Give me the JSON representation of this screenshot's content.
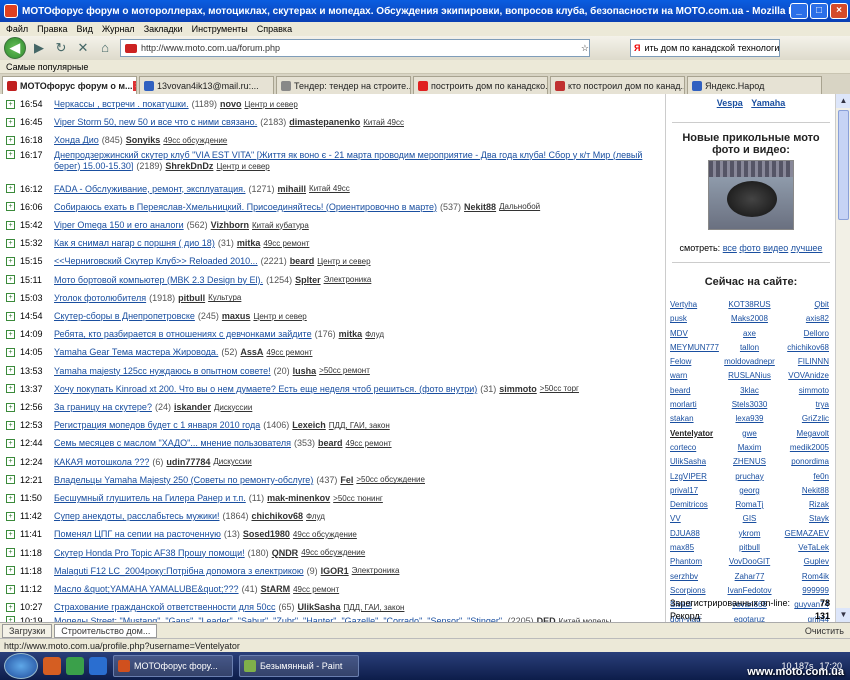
{
  "window": {
    "title": "МОТОфорус форум о мотороллерах, мотоциклах, скутерах и мопедах. Обсуждения экипировки, вопросов клуба, безопасности на MOTO.com.ua - Mozilla Firefox"
  },
  "menu": [
    "Файл",
    "Правка",
    "Вид",
    "Журнал",
    "Закладки",
    "Инструменты",
    "Справка"
  ],
  "address": {
    "url": "http://www.moto.com.ua/forum.php"
  },
  "search": {
    "engine": "Я",
    "value": "ить дом по канадской технологии"
  },
  "bookmarks": {
    "label": "Самые популярные"
  },
  "tabs": [
    {
      "label": "МОТОфорус форум о м...",
      "color": "#c02020"
    },
    {
      "label": "13vovan4ik13@mail.ru:...",
      "color": "#3060c0"
    },
    {
      "label": "Тендер: тендер на строите...",
      "color": "#888888"
    },
    {
      "label": "построить дом по канадско...",
      "color": "#e02020"
    },
    {
      "label": "кто построил дом по канад...",
      "color": "#c03030"
    },
    {
      "label": "Яндекс.Народ",
      "color": "#3060c0"
    }
  ],
  "topics": [
    {
      "time": "16:54",
      "title": "Черкассы , встречи . покатушки.",
      "count": "(1189)",
      "author": "novo",
      "cat": "Центр и север"
    },
    {
      "time": "16:45",
      "title": "Viper Storm 50, new 50 и все что с ними связано.",
      "count": "(2183)",
      "author": "dimastepanenko",
      "cat": "Китай 49сс"
    },
    {
      "time": "16:18",
      "title": "Хонда Дио",
      "count": "(845)",
      "author": "Sonyiks",
      "cat": "49сс обсуждение"
    },
    {
      "time": "16:17",
      "title": "Днепродзержинский скутер клуб \"VIA EST VITA\" [Життя як воно є - 21 марта проводим мероприятие - Два года клуба! Сбор у к/т Мир (левый берег) 15.00-15.30]",
      "count": "(2189)",
      "author": "ShrekDnDz",
      "cat": "Центр и север"
    },
    {
      "time": "16:12",
      "title": "FADA - Обслуживание, ремонт, эксплуатация.",
      "count": "(1271)",
      "author": "mihaill",
      "cat": "Китай 49сс"
    },
    {
      "time": "16:06",
      "title": "Собираюсь ехать в Переяслав-Хмельницкий. Присоединяйтесь! (Ориентировочно в марте)",
      "count": "(537)",
      "author": "Nekit88",
      "cat": "Дальнобой"
    },
    {
      "time": "15:42",
      "title": "Viper Omega 150 и его аналоги",
      "count": "(562)",
      "author": "Vizhborn",
      "cat": "Китай кубатура"
    },
    {
      "time": "15:32",
      "title": "Как я снимал нагар с поршня ( дио 18)",
      "count": "(31)",
      "author": "mitka",
      "cat": "49сс ремонт"
    },
    {
      "time": "15:15",
      "title": "<<Черниговский Скутер Клуб>> Reloaded 2010...",
      "count": "(2221)",
      "author": "beard",
      "cat": "Центр и север"
    },
    {
      "time": "15:11",
      "title": "Мото бортовой компьютер (MBK 2.3 Design by El).",
      "count": "(1254)",
      "author": "Splter",
      "cat": "Электроника"
    },
    {
      "time": "15:03",
      "title": "Уголок фотолюбителя",
      "count": "(1918)",
      "author": "pitbull",
      "cat": "Культура"
    },
    {
      "time": "14:54",
      "title": "Скутер-сборы в Днепропетровске",
      "count": "(245)",
      "author": "maxus",
      "cat": "Центр и север"
    },
    {
      "time": "14:09",
      "title": "Ребята, кто разбирается в отношениях с девчонками зайдите",
      "count": "(176)",
      "author": "mitka",
      "cat": "Флуд"
    },
    {
      "time": "14:05",
      "title": "Yamaha Gear Тема мастера Жировода.",
      "count": "(52)",
      "author": "AssA",
      "cat": "49сс ремонт"
    },
    {
      "time": "13:53",
      "title": "Yamaha majesty 125cc нуждаюсь в опытном совете!",
      "count": "(20)",
      "author": "lusha",
      "cat": ">50сс ремонт"
    },
    {
      "time": "13:37",
      "title": "Хочу покупать Kinroad xt 200. Что вы о нем думаете? Есть еще неделя чтоб решиться. (фото внутри)",
      "count": "(31)",
      "author": "simmoto",
      "cat": ">50сс торг"
    },
    {
      "time": "12:56",
      "title": "За границу на скутере?",
      "count": "(24)",
      "author": "iskander",
      "cat": "Дискуссии"
    },
    {
      "time": "12:53",
      "title": "Регистрация мопедов будет с 1 января 2010 года",
      "count": "(1406)",
      "author": "Lexeich",
      "cat": "ПДД, ГАИ, закон"
    },
    {
      "time": "12:44",
      "title": "Семь месяцев с маслом \"ХАДО\"... мнение пользователя",
      "count": "(353)",
      "author": "beard",
      "cat": "49сс ремонт"
    },
    {
      "time": "12:24",
      "title": "КАКАЯ мотошкола ???",
      "count": "(6)",
      "author": "udin77784",
      "cat": "Дискуссии"
    },
    {
      "time": "12:21",
      "title": "Владельцы Yamaha Majesty 250 (Советы по ремонту-обслуге)",
      "count": "(437)",
      "author": "Fel",
      "cat": ">50сс обсуждение"
    },
    {
      "time": "11:50",
      "title": "Бесшумный глушитель на Гилера Ранер и т.п.",
      "count": "(11)",
      "author": "mak-minenkov",
      "cat": ">50сс тюнинг"
    },
    {
      "time": "11:42",
      "title": "Супер анекдоты, расслабьтесь мужики!",
      "count": "(1864)",
      "author": "chichikov68",
      "cat": "Флуд"
    },
    {
      "time": "11:41",
      "title": "Поменял ЦПГ на сепии на расточенную",
      "count": "(13)",
      "author": "Sosed1980",
      "cat": "49сс обсуждение"
    },
    {
      "time": "11:18",
      "title": "Скутер Honda Pro Topic AF38 Прошу помощи!",
      "count": "(180)",
      "author": "QNDR",
      "cat": "49сс обсуждение"
    },
    {
      "time": "11:18",
      "title": "Malaguti F12 LC_2004року:Потрібна допомога з електрикою",
      "count": "(9)",
      "author": "IGOR1",
      "cat": "Электроника"
    },
    {
      "time": "11:12",
      "title": "Масло &quot;YAMAHA YAMALUBE&quot;???",
      "count": "(41)",
      "author": "StARM",
      "cat": "49сс ремонт"
    },
    {
      "time": "10:27",
      "title": "Страхование гражданской ответственности для 50сс",
      "count": "(65)",
      "author": "UlikSasha",
      "cat": "ПДД, ГАИ, закон"
    },
    {
      "time": "10:19",
      "title": "Мопеды Street: \"Mustang\", \"Gans\", \"Leader\", \"Sabur\", \"Zubr\", \"Hanter\", \"Gazelle\", \"Corrado\", \"Sensor\", \"Stinger\".",
      "count": "(2205)",
      "author": "DED",
      "cat": "Китай мопеды"
    }
  ],
  "sidebar": {
    "top_links": [
      "Vespa",
      "Yamaha"
    ],
    "photo_title": "Новые прикольные мото фото и видео:",
    "links_prefix": "смотреть:",
    "links": [
      "все",
      "фото",
      "видео",
      "лучшее"
    ],
    "online_title": "Сейчас на сайте:",
    "users": [
      "Vertyha",
      "KOT38RUS",
      "Qbit",
      "pusk",
      "Maks2008",
      "axis82",
      "MDV",
      "axe",
      "Delloro",
      "MEYMUN777",
      "tallon",
      "chichikov68",
      "Felow",
      "moldovadnepr",
      "FILINNN",
      "warn",
      "RUSLANius",
      "VOVAnidze",
      "beard",
      "3klac",
      "simmoto",
      "morlarti",
      "Stels3030",
      "trya",
      "stakan",
      "lexa939",
      "GriZzlic",
      "Ventelyator",
      "gwe",
      "Megavolt",
      "corteco",
      "Maxim",
      "medik2005",
      "UlikSasha",
      "ZHENUS",
      "ponordima",
      "LzgVIPER",
      "pruchay",
      "fe0n",
      "prival17",
      "georg",
      "Nekit88",
      "Demitricos",
      "RomaTj",
      "Rizak",
      "VV",
      "GIS",
      "Stayk",
      "DJUA88",
      "ykrom",
      "GEMAZAEV",
      "max85",
      "pitbull",
      "VeTaLek",
      "Phantom",
      "VovDooGIT",
      "Guplev",
      "serzhbv",
      "Zahar77",
      "Rom4ik",
      "Scorpions",
      "IvanFedotov",
      "999999",
      "Slvadi",
      "vovan666",
      "guyvan74",
      "don-vlad",
      "egotaruz",
      "grill44",
      "139QMB",
      "Vanchik_11",
      "Viper_Honda",
      "Sime_Mahatu",
      "Jeka_SAMURAY",
      "Pasha_ak-47",
      "alexey_m",
      "130_s_gorki",
      "moto_yura"
    ],
    "stats": [
      {
        "label": "Зарегистрированных on-line:",
        "value": "78"
      },
      {
        "label": "Рекорд:",
        "value": "131"
      }
    ]
  },
  "findbar": {
    "tabs": [
      "Загрузки",
      "Строительство дом..."
    ],
    "clear": "Очистить"
  },
  "status": {
    "text": "http://www.moto.com.ua/profile.php?username=Ventelyator"
  },
  "taskbar": {
    "tasks": [
      {
        "label": "МОТОфорус фору...",
        "color": "#d0501e"
      },
      {
        "label": "Безымянный - Paint",
        "color": "#7fb04a"
      }
    ],
    "speed": "10.187s",
    "clock": "17:20"
  },
  "watermark": "www.moto.com.ua"
}
